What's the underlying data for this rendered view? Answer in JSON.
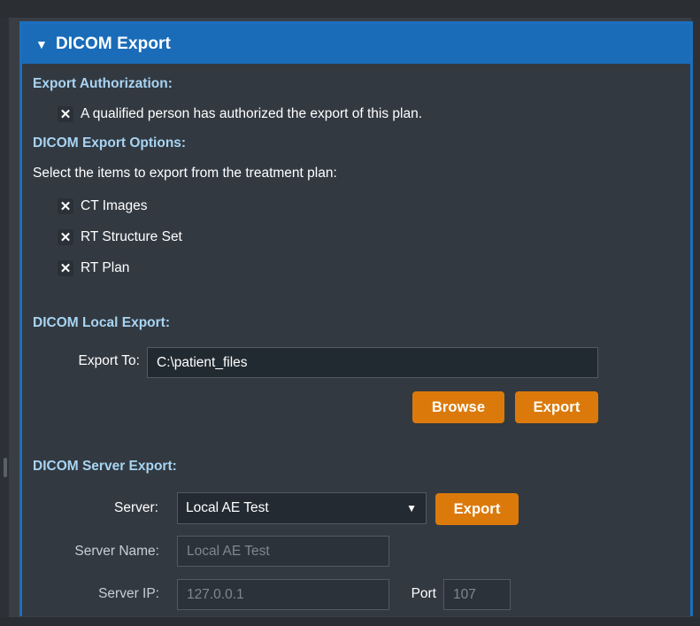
{
  "panel": {
    "title": "DICOM Export",
    "toggle_icon": "caret-down-icon"
  },
  "authorization": {
    "section_title": "Export Authorization:",
    "checkbox_label": "A qualified person has authorized the export of this plan.",
    "checked": true
  },
  "options": {
    "section_title": "DICOM Export Options:",
    "instruction": "Select the items to export from the treatment plan:",
    "items": [
      {
        "label": "CT Images",
        "checked": true
      },
      {
        "label": "RT Structure Set",
        "checked": true
      },
      {
        "label": "RT Plan",
        "checked": true
      }
    ]
  },
  "local_export": {
    "section_title": "DICOM Local Export:",
    "export_to_label": "Export To:",
    "export_to_value": "C:\\patient_files",
    "browse_label": "Browse",
    "export_label": "Export"
  },
  "server_export": {
    "section_title": "DICOM Server Export:",
    "server_label": "Server:",
    "server_value": "Local AE Test",
    "export_label": "Export",
    "server_name_label": "Server Name:",
    "server_name_value": "Local AE Test",
    "server_ip_label": "Server IP:",
    "server_ip_value": "127.0.0.1",
    "port_label": "Port",
    "port_value": "107"
  },
  "colors": {
    "header_blue": "#1a6cb9",
    "section_title": "#a8d4f2",
    "button_orange": "#db7a0b",
    "panel_bg": "#323941"
  }
}
